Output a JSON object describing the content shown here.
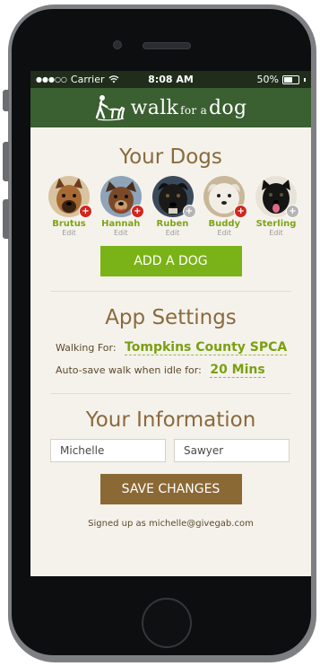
{
  "status_bar": {
    "carrier": "Carrier",
    "time": "8:08 AM",
    "battery": "50%"
  },
  "header": {
    "brand_walk": "walk",
    "brand_for_a": "for a",
    "brand_dog": "dog",
    "colors": {
      "header_bg": "#3a5f31",
      "accent_green": "#7ab317",
      "brown": "#8b6935"
    }
  },
  "dogs": {
    "title": "Your Dogs",
    "items": [
      {
        "name": "Brutus",
        "edit": "Edit",
        "badge": "red-plus-icon"
      },
      {
        "name": "Hannah",
        "edit": "Edit",
        "badge": "red-plus-icon"
      },
      {
        "name": "Ruben",
        "edit": "Edit",
        "badge": "gray-plus-icon"
      },
      {
        "name": "Buddy",
        "edit": "Edit",
        "badge": "red-plus-icon"
      },
      {
        "name": "Sterling",
        "edit": "Edit",
        "badge": "gray-plus-icon"
      }
    ],
    "add_button": "ADD A DOG"
  },
  "settings": {
    "title": "App Settings",
    "walking_for_label": "Walking For:",
    "walking_for_value": "Tompkins County SPCA",
    "autosave_label": "Auto-save walk when idle for:",
    "autosave_value": "20 Mins"
  },
  "info": {
    "title": "Your Information",
    "first_name": "Michelle",
    "last_name": "Sawyer",
    "save_button": "SAVE CHANGES",
    "signed_up": "Signed up as michelle@givegab.com"
  }
}
